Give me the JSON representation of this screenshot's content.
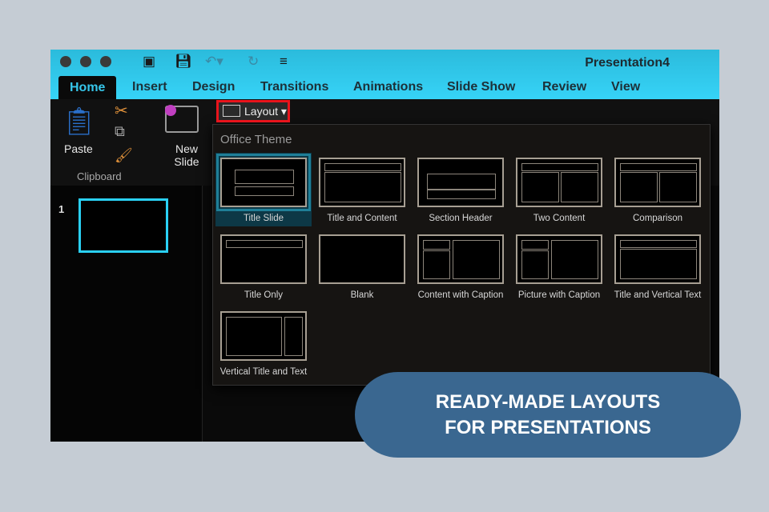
{
  "window": {
    "title": "Presentation4"
  },
  "tabs": [
    "Home",
    "Insert",
    "Design",
    "Transitions",
    "Animations",
    "Slide Show",
    "Review",
    "View"
  ],
  "ribbon": {
    "paste": "Paste",
    "new_slide": "New Slide",
    "clipboard_group": "Clipboard",
    "layout": "Layout"
  },
  "slides": [
    {
      "number": "1"
    }
  ],
  "layout_menu": {
    "title": "Office Theme",
    "items": [
      "Title Slide",
      "Title and Content",
      "Section Header",
      "Two Content",
      "Comparison",
      "Title Only",
      "Blank",
      "Content with Caption",
      "Picture with Caption",
      "Title and Vertical Text",
      "Vertical Title and Text"
    ],
    "selected": "Title Slide"
  },
  "banner": {
    "line1": "READY-MADE LAYOUTS",
    "line2": "FOR PRESENTATIONS"
  },
  "colors": {
    "accent": "#2ad0f5",
    "highlight": "#e8141c",
    "banner": "#3a6790"
  }
}
